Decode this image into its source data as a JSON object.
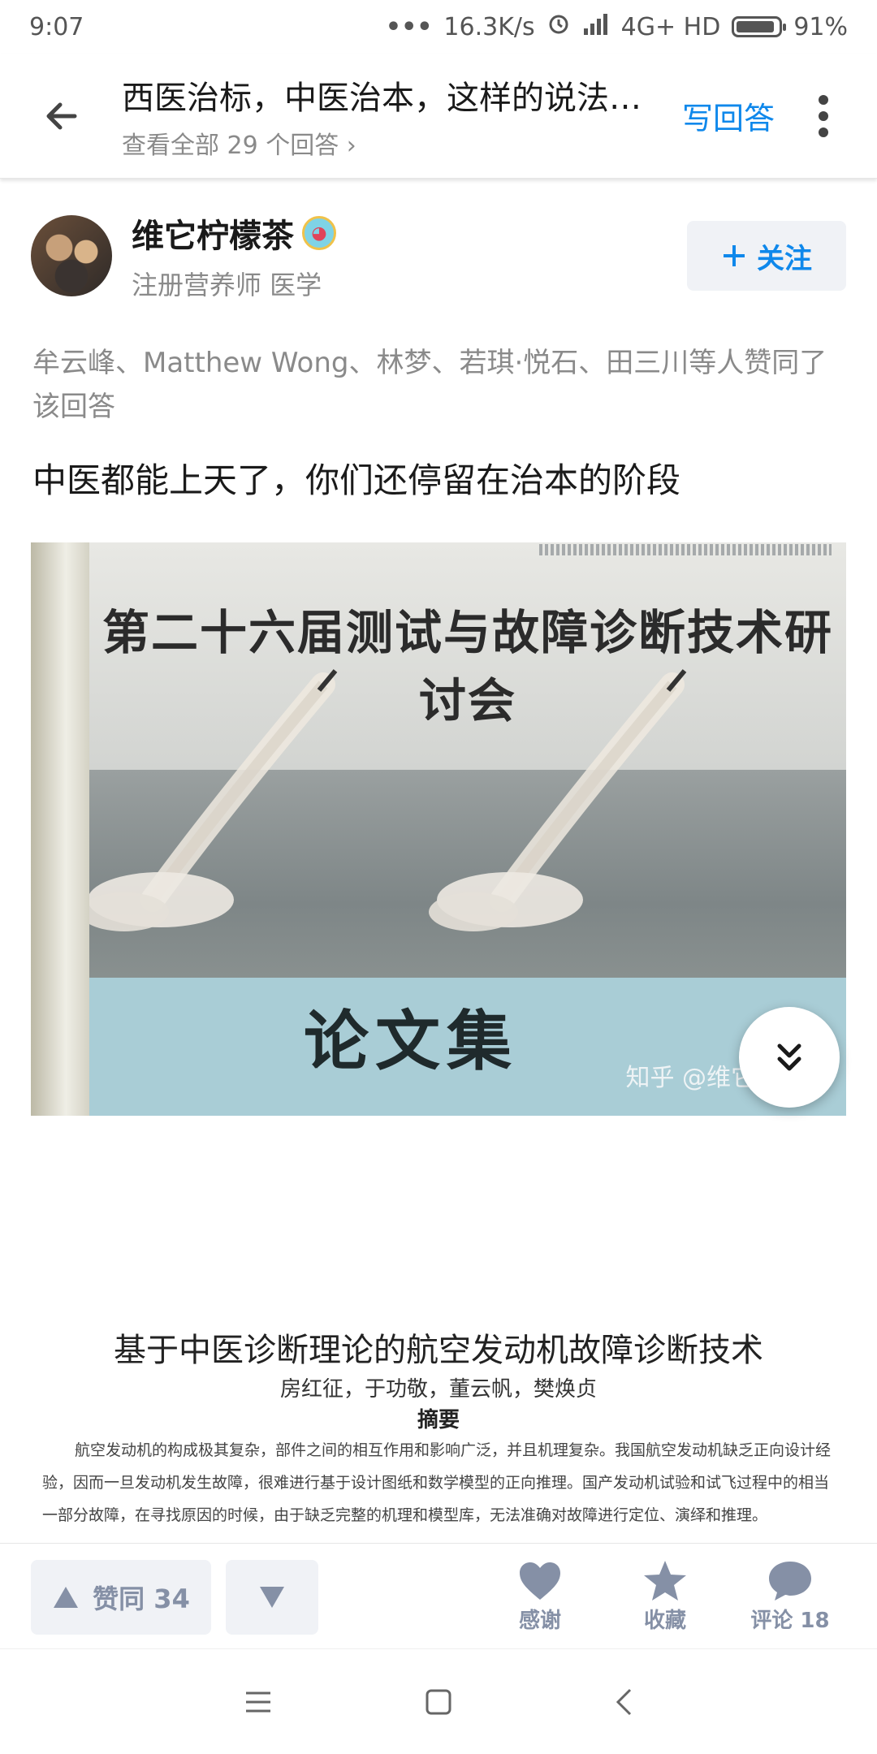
{
  "status_bar": {
    "time": "9:07",
    "network_speed": "16.3K/s",
    "signal": "4G+ HD",
    "battery": "91%",
    "battery_level": 0.91
  },
  "header": {
    "title": "西医治标，中医治本，这样的说法…",
    "subtitle": "查看全部 29 个回答 ›",
    "write_answer": "写回答"
  },
  "author": {
    "name": "维它柠檬茶",
    "description": "注册营养师 医学",
    "follow_label": "关注"
  },
  "likers_text": "牟云峰、Matthew Wong、林梦、若琪·悦石、田三川等人赞同了该回答",
  "answer_text": "中医都能上天了，你们还停留在治本的阶段",
  "image_cover": {
    "title": "第二十六届测试与故障诊断技术研讨会",
    "bottom_title": "论文集",
    "watermark": "知乎 @维它"
  },
  "image_paper": {
    "title": "基于中医诊断理论的航空发动机故障诊断技术",
    "authors": "房红征，于功敬，董云帆，樊焕贞",
    "abstract_heading": "摘要",
    "abstract": "航空发动机的构成极其复杂，部件之间的相互作用和影响广泛，并且机理复杂。我国航空发动机缺乏正向设计经验，因而一旦发动机发生故障，很难进行基于设计图纸和数学模型的正向推理。国产发动机试验和试飞过程中的相当一部分故障，在寻找原因的时候，由于缺乏完整的机理和模型库，无法准确对故障进行定位、演绎和推理。"
  },
  "actions": {
    "upvote_label": "赞同 34",
    "thanks_label": "感谢",
    "collect_label": "收藏",
    "comment_label": "评论 18"
  },
  "colors": {
    "accent": "#0f88eb",
    "muted": "#8590a6"
  }
}
